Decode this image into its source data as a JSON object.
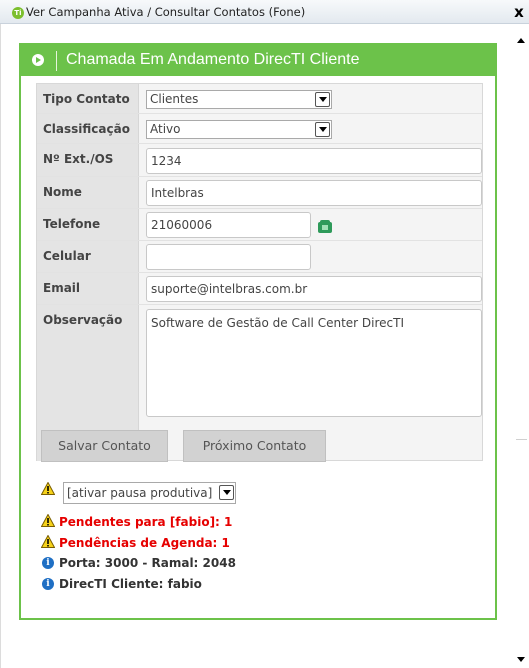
{
  "window": {
    "app_icon_text": "Ti",
    "title": "Ver Campanha Ativa / Consultar Contatos (Fone)",
    "close_label": "x"
  },
  "panel": {
    "title": "Chamada Em Andamento DirecTI Cliente",
    "accent_color": "#6cc24a"
  },
  "form": {
    "tipo_contato": {
      "label": "Tipo Contato",
      "value": "Clientes"
    },
    "classificacao": {
      "label": "Classificação",
      "value": "Ativo"
    },
    "ext_os": {
      "label": "Nº Ext./OS",
      "value": "1234"
    },
    "nome": {
      "label": "Nome",
      "value": "Intelbras"
    },
    "telefone": {
      "label": "Telefone",
      "value": "21060006",
      "action_icon": "phone-icon"
    },
    "celular": {
      "label": "Celular",
      "value": ""
    },
    "email": {
      "label": "Email",
      "value": "suporte@intelbras.com.br"
    },
    "observacao": {
      "label": "Observação",
      "value": "Software de Gestão de Call Center DirecTI"
    }
  },
  "buttons": {
    "save": "Salvar Contato",
    "next": "Próximo Contato"
  },
  "status": {
    "pause_select": "[ativar pausa produtiva]",
    "pending_fabio": "Pendentes para [fabio]: 1",
    "agenda_pending": "Pendências de Agenda: 1",
    "port_extension": "Porta: 3000 - Ramal: 2048",
    "directi_client": "DirecTI Cliente: fabio",
    "warning_color": "#e60000",
    "info_color": "#1f6fc4"
  }
}
